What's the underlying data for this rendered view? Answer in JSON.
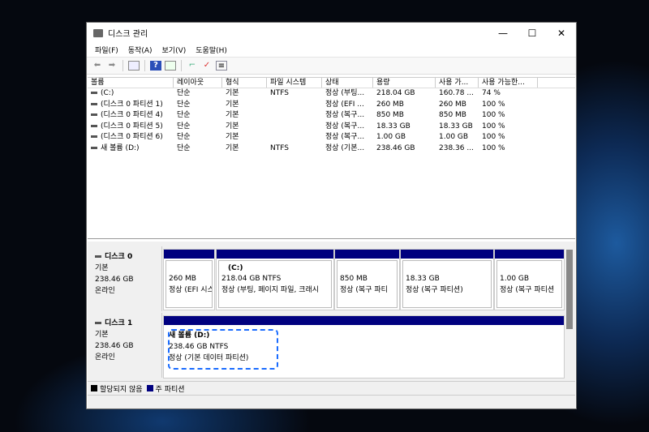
{
  "title": "디스크 관리",
  "menu": [
    "파일(F)",
    "동작(A)",
    "보기(V)",
    "도움말(H)"
  ],
  "columns": [
    "볼륨",
    "레이아웃",
    "형식",
    "파일 시스템",
    "상태",
    "용량",
    "사용 가...",
    "사용 가능한..."
  ],
  "rows": [
    [
      "(C:)",
      "단순",
      "기본",
      "NTFS",
      "정상 (부팅...",
      "218.04 GB",
      "160.78 ...",
      "74 %"
    ],
    [
      "(디스크 0 파티션 1)",
      "단순",
      "기본",
      "",
      "정상 (EFI ...",
      "260 MB",
      "260 MB",
      "100 %"
    ],
    [
      "(디스크 0 파티션 4)",
      "단순",
      "기본",
      "",
      "정상 (복구...",
      "850 MB",
      "850 MB",
      "100 %"
    ],
    [
      "(디스크 0 파티션 5)",
      "단순",
      "기본",
      "",
      "정상 (복구...",
      "18.33 GB",
      "18.33 GB",
      "100 %"
    ],
    [
      "(디스크 0 파티션 6)",
      "단순",
      "기본",
      "",
      "정상 (복구...",
      "1.00 GB",
      "1.00 GB",
      "100 %"
    ],
    [
      "새 볼륨 (D:)",
      "단순",
      "기본",
      "NTFS",
      "정상 (기본...",
      "238.46 GB",
      "238.36 ...",
      "100 %"
    ]
  ],
  "disks": [
    {
      "name": "디스크 0",
      "type": "기본",
      "size": "238.46 GB",
      "status": "온라인",
      "partitions": [
        {
          "name": "",
          "size": "260 MB",
          "status": "정상 (EFI 시스"
        },
        {
          "name": "(C:)",
          "size": "218.04 GB NTFS",
          "status": "정상 (부팅, 페이지 파일, 크래시"
        },
        {
          "name": "",
          "size": "850 MB",
          "status": "정상 (복구 파티"
        },
        {
          "name": "",
          "size": "18.33 GB",
          "status": "정상 (복구 파티션)"
        },
        {
          "name": "",
          "size": "1.00 GB",
          "status": "정상 (복구 파티션"
        }
      ]
    },
    {
      "name": "디스크 1",
      "type": "기본",
      "size": "238.46 GB",
      "status": "온라인",
      "partitions": [
        {
          "name": "새 볼륨  (D:)",
          "size": "238.46 GB NTFS",
          "status": "정상 (기본 데이터 파티션)"
        }
      ]
    }
  ],
  "legend": [
    {
      "label": "할당되지 않음",
      "color": "#000000"
    },
    {
      "label": "주 파티션",
      "color": "#00007f"
    }
  ]
}
